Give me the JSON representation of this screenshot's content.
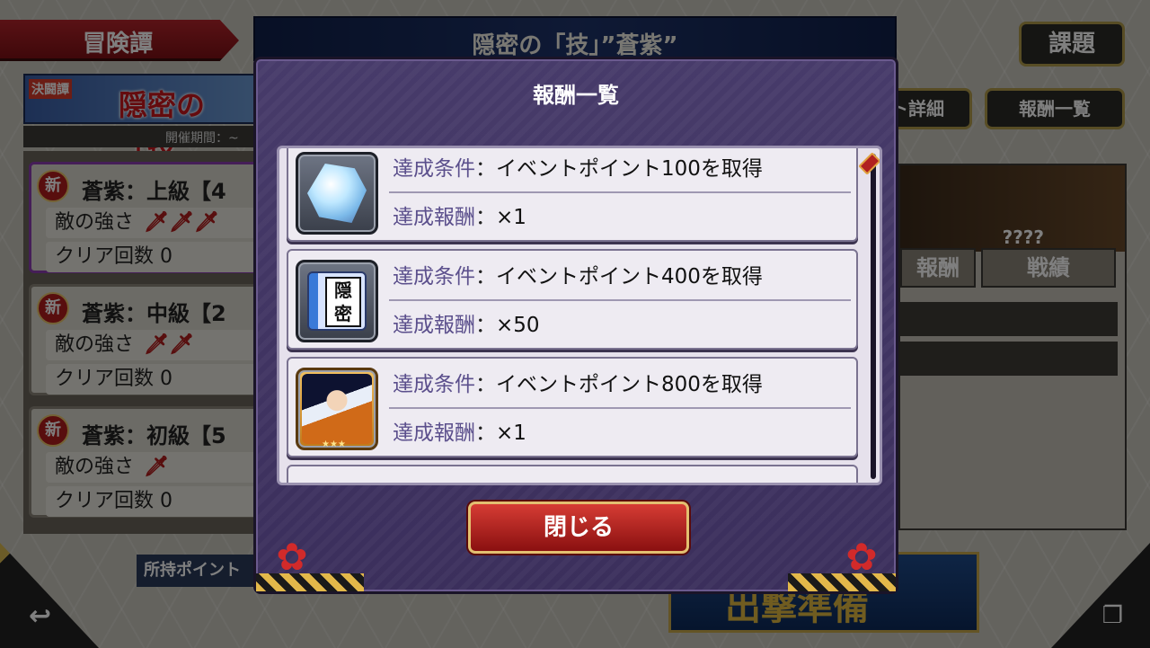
{
  "background": {
    "section_title": "冒険譚",
    "stage_title": "隠密の「技」”蒼紫”",
    "mission_button": "課題",
    "event_banner_label": "決闘譚",
    "event_banner_title": "隠密の「技",
    "period_text": "開催期間：~",
    "event_detail_tab": "ト詳細",
    "rewards_tab": "報酬一覧",
    "portrait_caption": "????",
    "subtab_reward": "報酬",
    "subtab_record": "戦績",
    "stages": [
      {
        "new_badge": "新",
        "name": "蒼紫：上級【4",
        "enemy_label": "敵の強さ",
        "enemy_level": "🗡🗡🗡",
        "clear_label": "クリア回数",
        "clear_count": "0"
      },
      {
        "new_badge": "新",
        "name": "蒼紫：中級【2",
        "enemy_label": "敵の強さ",
        "enemy_level": "🗡🗡",
        "clear_label": "クリア回数",
        "clear_count": "0"
      },
      {
        "new_badge": "新",
        "name": "蒼紫：初級【5",
        "enemy_label": "敵の強さ",
        "enemy_level": "🗡",
        "clear_label": "クリア回数",
        "clear_count": "0"
      }
    ],
    "points_label": "所持ポイント",
    "back_icon": "↩",
    "copy_icon": "❐",
    "start_banner": "出撃準備"
  },
  "modal": {
    "title": "報酬一覧",
    "condition_label": "達成条件",
    "reward_label": "達成報酬",
    "colon": "：",
    "items": [
      {
        "icon": "crystal-icon",
        "condition": "イベントポイント100を取得",
        "reward": "×1"
      },
      {
        "icon": "scroll-icon",
        "icon_text": "隠密",
        "condition": "イベントポイント400を取得",
        "reward": "×50"
      },
      {
        "icon": "character-icon",
        "condition": "イベントポイント800を取得",
        "reward": "×1"
      }
    ],
    "close_button": "閉じる"
  },
  "colors": {
    "modal_bg": "#473b6a",
    "label_purple": "#5b4f8c",
    "button_red": "#b02020",
    "gold": "#e3c070"
  }
}
